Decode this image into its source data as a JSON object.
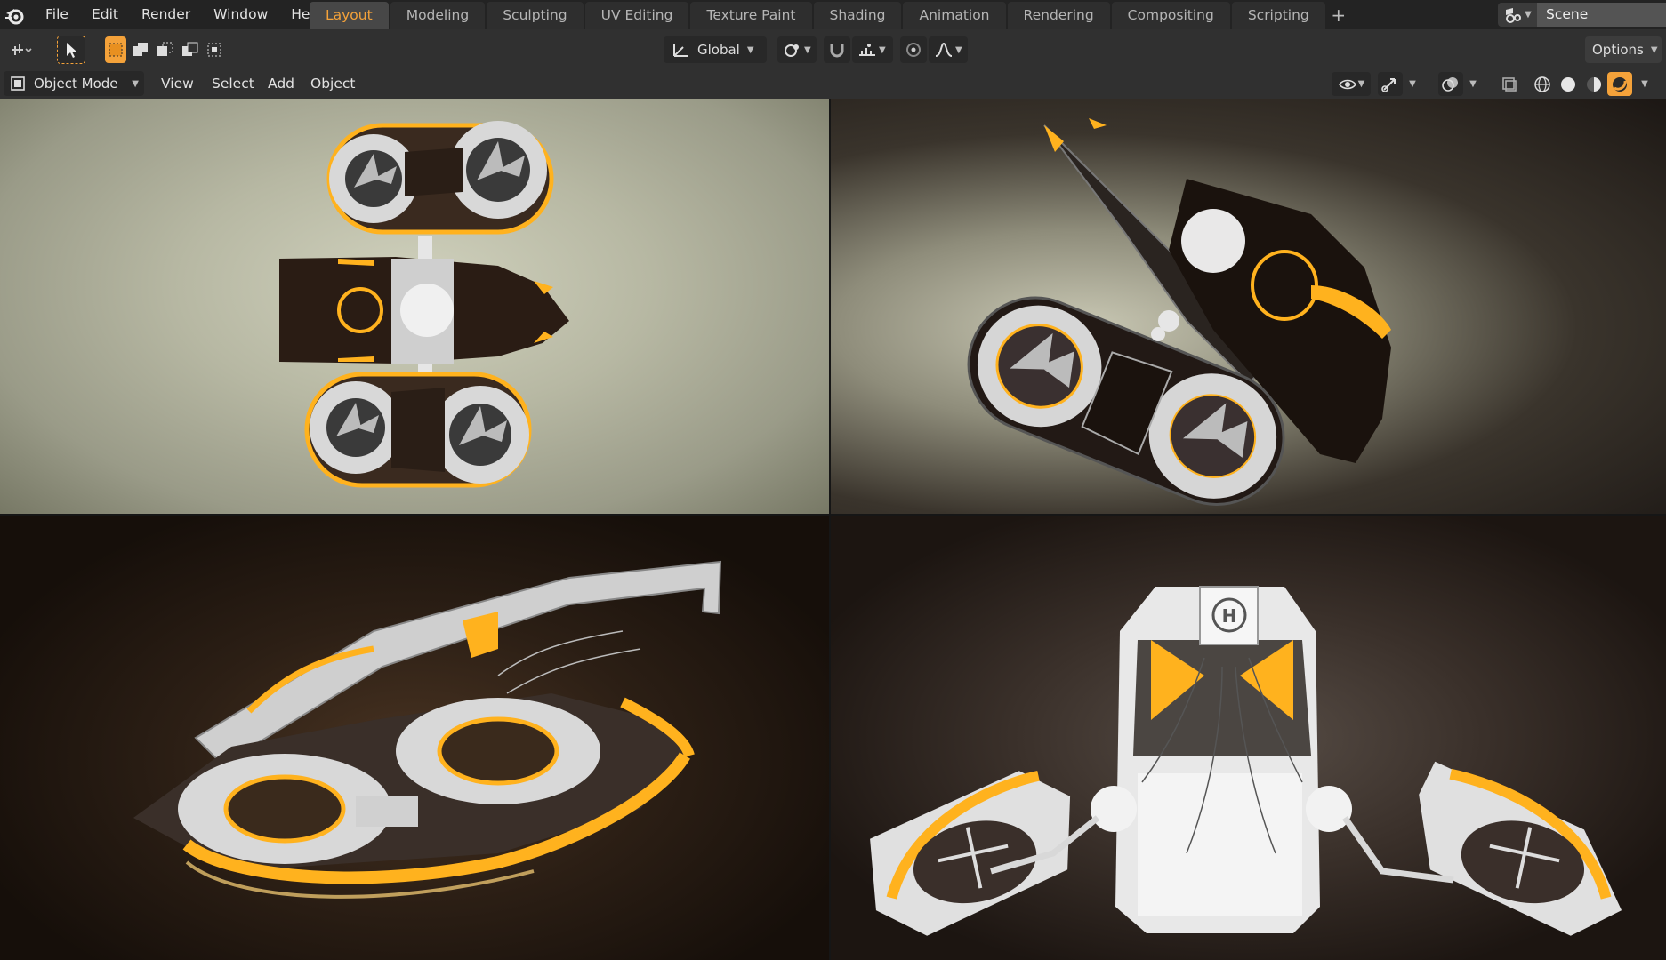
{
  "menu": {
    "file": "File",
    "edit": "Edit",
    "render": "Render",
    "window": "Window",
    "help": "Help"
  },
  "workspaces": [
    {
      "label": "Layout",
      "active": true
    },
    {
      "label": "Modeling",
      "active": false
    },
    {
      "label": "Sculpting",
      "active": false
    },
    {
      "label": "UV Editing",
      "active": false
    },
    {
      "label": "Texture Paint",
      "active": false
    },
    {
      "label": "Shading",
      "active": false
    },
    {
      "label": "Animation",
      "active": false
    },
    {
      "label": "Rendering",
      "active": false
    },
    {
      "label": "Compositing",
      "active": false
    },
    {
      "label": "Scripting",
      "active": false
    }
  ],
  "add_workspace": "+",
  "scene": {
    "name": "Scene"
  },
  "toolheader": {
    "transform_orientation": "Global",
    "options_label": "Options"
  },
  "viewheader": {
    "mode": "Object Mode",
    "view": "View",
    "select": "Select",
    "add": "Add",
    "object": "Object"
  },
  "colors": {
    "accent": "#f4a23a",
    "selected": "#5680c2",
    "glow": "#ffb21e"
  },
  "icons": {
    "logo": "blender-logo-icon",
    "pivot": "pivot-icon",
    "select": "cursor-select-icon",
    "snap": "magnet-icon",
    "proportional": "proportional-edit-icon",
    "viewport_shading": [
      "wireframe-icon",
      "solid-icon",
      "material-icon",
      "rendered-icon"
    ]
  }
}
